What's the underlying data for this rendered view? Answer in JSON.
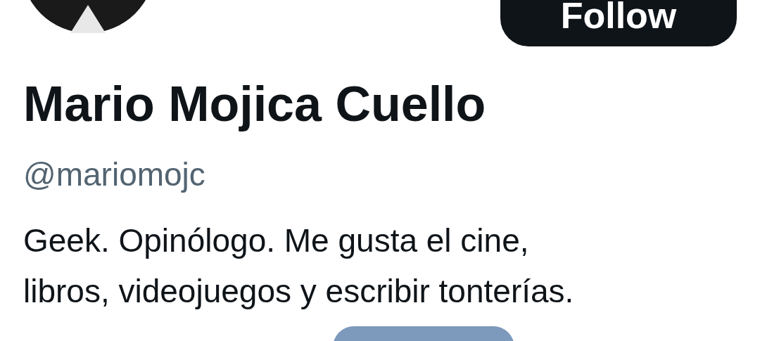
{
  "profile": {
    "follow_button": "Follow",
    "name": "Mario Mojica Cuello",
    "handle": "@mariomojc",
    "bio_lines": [
      "Geek. Opinólogo. Me gusta el cine,",
      "libros, videojuegos y escribir tonterías."
    ]
  }
}
